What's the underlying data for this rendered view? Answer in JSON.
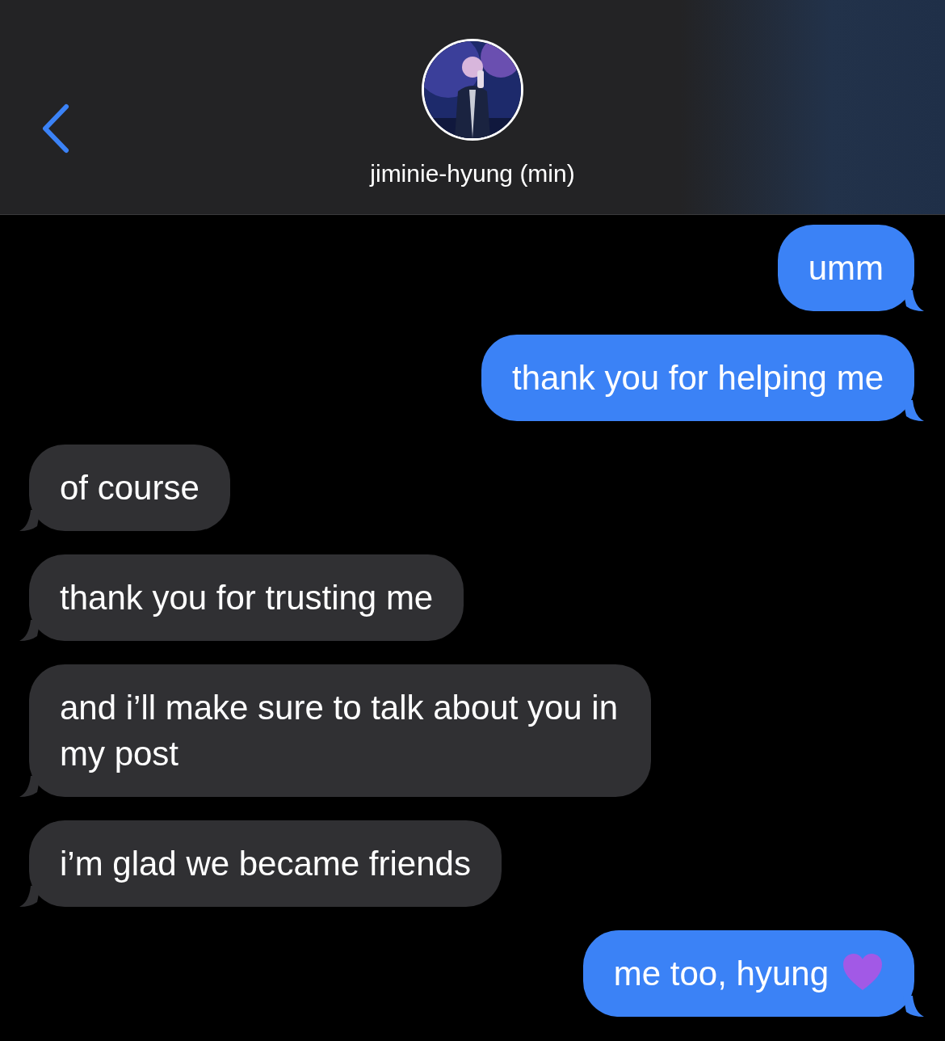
{
  "header": {
    "contact_name": "jiminie-hyung (min)"
  },
  "messages": [
    {
      "kind": "sent",
      "text": "umm"
    },
    {
      "kind": "sent",
      "text": "thank you for helping me"
    },
    {
      "kind": "received",
      "text": "of course"
    },
    {
      "kind": "received",
      "text": "thank you for trusting me"
    },
    {
      "kind": "received",
      "text": "and i’ll make sure to talk about you in my post"
    },
    {
      "kind": "received",
      "text": "i’m glad we became friends"
    },
    {
      "kind": "sent",
      "text": "me too, hyung",
      "heart_icon": true
    }
  ]
}
